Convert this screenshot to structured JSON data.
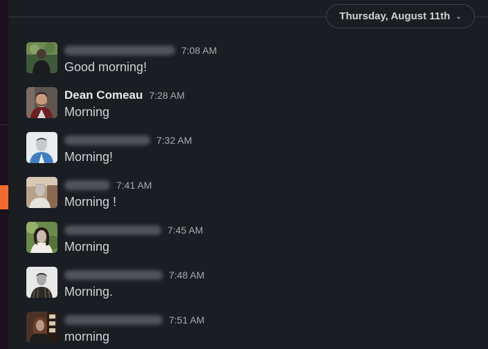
{
  "date_divider": {
    "label": "Thursday, August 11th",
    "chevron_icon": "chevron-down-icon"
  },
  "colors": {
    "background": "#1a1d21",
    "sidebar": "#1e0f1e",
    "unread_marker": "#f26a2e",
    "message_text": "#d1d2d3",
    "timestamp": "#ababad"
  },
  "messages": [
    {
      "author": "",
      "author_redacted": true,
      "time": "7:08 AM",
      "text": "Good morning!"
    },
    {
      "author": "Dean Comeau",
      "author_redacted": false,
      "time": "7:28 AM",
      "text": "Morning"
    },
    {
      "author": "",
      "author_redacted": true,
      "time": "7:32 AM",
      "text": "Morning!"
    },
    {
      "author": "",
      "author_redacted": true,
      "time": "7:41 AM",
      "text": "Morning !"
    },
    {
      "author": "",
      "author_redacted": true,
      "time": "7:45 AM",
      "text": "Morning"
    },
    {
      "author": "",
      "author_redacted": true,
      "time": "7:48 AM",
      "text": "Morning."
    },
    {
      "author": "",
      "author_redacted": true,
      "time": "7:51 AM",
      "text": "morning"
    }
  ]
}
